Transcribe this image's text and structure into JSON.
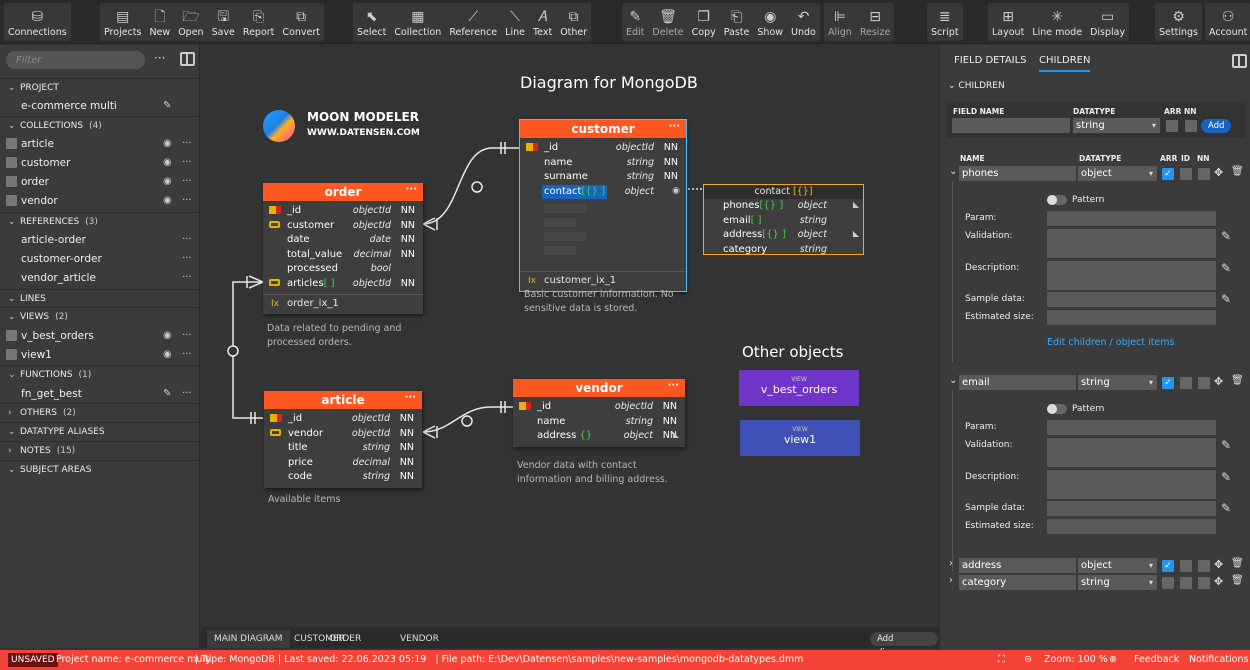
{
  "toolbar": {
    "groups": [
      [
        {
          "icon": "database-icon",
          "label": "Connections"
        }
      ],
      [
        {
          "icon": "projects-icon",
          "label": "Projects"
        },
        {
          "icon": "new-file-icon",
          "label": "New"
        },
        {
          "icon": "folder-open-icon",
          "label": "Open"
        },
        {
          "icon": "save-icon",
          "label": "Save"
        },
        {
          "icon": "report-icon",
          "label": "Report"
        },
        {
          "icon": "convert-icon",
          "label": "Convert"
        }
      ],
      [
        {
          "icon": "cursor-icon",
          "label": "Select"
        },
        {
          "icon": "collection-icon",
          "label": "Collection"
        },
        {
          "icon": "reference-icon",
          "label": "Reference"
        },
        {
          "icon": "line-icon",
          "label": "Line"
        },
        {
          "icon": "text-icon",
          "label": "Text"
        },
        {
          "icon": "other-icon",
          "label": "Other"
        }
      ],
      [
        {
          "icon": "edit-icon",
          "label": "Edit",
          "disabled": true
        },
        {
          "icon": "trash-icon",
          "label": "Delete",
          "disabled": true
        },
        {
          "icon": "copy-icon",
          "label": "Copy"
        },
        {
          "icon": "paste-icon",
          "label": "Paste"
        },
        {
          "icon": "eye-icon",
          "label": "Show"
        },
        {
          "icon": "undo-icon",
          "label": "Undo"
        }
      ],
      [
        {
          "icon": "align-icon",
          "label": "Align",
          "disabled": true
        },
        {
          "icon": "resize-icon",
          "label": "Resize",
          "disabled": true
        }
      ],
      [
        {
          "icon": "script-icon",
          "label": "Script"
        }
      ],
      [
        {
          "icon": "layout-icon",
          "label": "Layout"
        },
        {
          "icon": "line-mode-icon",
          "label": "Line mode"
        },
        {
          "icon": "display-icon",
          "label": "Display"
        }
      ],
      [
        {
          "icon": "gear-icon",
          "label": "Settings"
        }
      ],
      [
        {
          "icon": "user-icon",
          "label": "Account"
        }
      ]
    ]
  },
  "sidebar": {
    "filter_placeholder": "Filter",
    "project": {
      "title": "PROJECT",
      "name": "e-commerce multi"
    },
    "collections": {
      "title": "COLLECTIONS",
      "count": "(4)",
      "items": [
        "article",
        "customer",
        "order",
        "vendor"
      ]
    },
    "references": {
      "title": "REFERENCES",
      "count": "(3)",
      "items": [
        "article-order",
        "customer-order",
        "vendor_article"
      ]
    },
    "lines": {
      "title": "LINES"
    },
    "views": {
      "title": "VIEWS",
      "count": "(2)",
      "items": [
        "v_best_orders",
        "view1"
      ]
    },
    "functions": {
      "title": "FUNCTIONS",
      "count": "(1)",
      "items": [
        "fn_get_best"
      ]
    },
    "others": {
      "title": "OTHERS",
      "count": "(2)"
    },
    "aliases": {
      "title": "DATATYPE ALIASES"
    },
    "notes": {
      "title": "NOTES",
      "count": "(15)"
    },
    "subject_areas": {
      "title": "SUBJECT AREAS"
    }
  },
  "diagram": {
    "title": "Diagram for MongoDB",
    "logo": {
      "name": "MOON MODELER",
      "url": "WWW.DATENSEN.COM"
    },
    "entities": {
      "order": {
        "name": "order",
        "fields": [
          {
            "icon": "key",
            "name": "_id",
            "type": "objectId",
            "nn": "NN"
          },
          {
            "icon": "fk",
            "name": "customer",
            "type": "objectId",
            "nn": "NN"
          },
          {
            "icon": "",
            "name": "date",
            "type": "date",
            "nn": "NN"
          },
          {
            "icon": "",
            "name": "total_value",
            "type": "decimal",
            "nn": "NN"
          },
          {
            "icon": "",
            "name": "processed",
            "type": "bool",
            "nn": ""
          },
          {
            "icon": "fk",
            "name": "articles",
            "suffix": "[ ]",
            "type": "objectId",
            "nn": "NN"
          }
        ],
        "index": "order_ix_1",
        "note": "Data related to pending and processed orders."
      },
      "customer": {
        "name": "customer",
        "fields": [
          {
            "icon": "key",
            "name": "_id",
            "type": "objectId",
            "nn": "NN"
          },
          {
            "icon": "",
            "name": "name",
            "type": "string",
            "nn": "NN"
          },
          {
            "icon": "",
            "name": "surname",
            "type": "string",
            "nn": "NN"
          },
          {
            "icon": "",
            "name": "contact",
            "suffix": "[{} ]",
            "type": "object",
            "nn": ""
          }
        ],
        "index": "customer_ix_1",
        "note": "Basic customer information. No sensitive data is stored."
      },
      "article": {
        "name": "article",
        "fields": [
          {
            "icon": "key",
            "name": "_id",
            "type": "objectId",
            "nn": "NN"
          },
          {
            "icon": "fk",
            "name": "vendor",
            "type": "objectId",
            "nn": "NN"
          },
          {
            "icon": "",
            "name": "title",
            "type": "string",
            "nn": "NN"
          },
          {
            "icon": "",
            "name": "price",
            "type": "decimal",
            "nn": "NN"
          },
          {
            "icon": "",
            "name": "code",
            "type": "string",
            "nn": "NN"
          }
        ],
        "note": "Available items"
      },
      "vendor": {
        "name": "vendor",
        "fields": [
          {
            "icon": "key",
            "name": "_id",
            "type": "objectId",
            "nn": "NN"
          },
          {
            "icon": "",
            "name": "name",
            "type": "string",
            "nn": "NN"
          },
          {
            "icon": "",
            "name": "address",
            "suffix": " {}",
            "type": "object",
            "nn": "NN"
          }
        ],
        "note": "Vendor data with contact information and billing address."
      },
      "contact": {
        "name": "contact",
        "suffix": " [{}]",
        "fields": [
          {
            "name": "phones",
            "suffix": "[{} ]",
            "type": "object"
          },
          {
            "name": "email",
            "suffix": "[ ]",
            "type": "string"
          },
          {
            "name": "address",
            "suffix": "[{} ]",
            "type": "object"
          },
          {
            "name": "category",
            "suffix": "",
            "type": "string"
          }
        ]
      }
    },
    "other_objects_title": "Other objects",
    "views": [
      {
        "kind": "VIEW",
        "name": "v_best_orders",
        "color": "#6f35c8"
      },
      {
        "kind": "VIEW",
        "name": "view1",
        "color": "#3f51b5"
      }
    ],
    "tabs": [
      "MAIN DIAGRAM",
      "CUSTOMER",
      "ORDER",
      "VENDOR"
    ],
    "add_diagram": "Add diagram"
  },
  "right_panel": {
    "tabs": [
      "FIELD DETAILS",
      "CHILDREN"
    ],
    "active_tab": "CHILDREN",
    "section": "CHILDREN",
    "new_field": {
      "name_label": "FIELD NAME",
      "datatype_label": "DATATYPE",
      "arr_label": "ARR",
      "nn_label": "NN",
      "datatype": "string",
      "add": "Add"
    },
    "list_headers": {
      "name": "NAME",
      "datatype": "DATATYPE",
      "arr": "ARR",
      "id": "ID",
      "nn": "NN"
    },
    "children": [
      {
        "name": "phones",
        "datatype": "object",
        "arr": true,
        "id": false,
        "nn": false,
        "expanded": true
      },
      {
        "name": "email",
        "datatype": "string",
        "arr": true,
        "id": false,
        "nn": false,
        "expanded": true
      },
      {
        "name": "address",
        "datatype": "object",
        "arr": true,
        "id": false,
        "nn": false,
        "expanded": false
      },
      {
        "name": "category",
        "datatype": "string",
        "arr": false,
        "id": false,
        "nn": false,
        "expanded": false
      }
    ],
    "detail_labels": {
      "pattern": "Pattern",
      "param": "Param:",
      "validation": "Validation:",
      "description": "Description:",
      "sample": "Sample data:",
      "size": "Estimated size:"
    },
    "edit_children_link": "Edit children / object items"
  },
  "status": {
    "badge": "UNSAVED",
    "project": "Project name: e-commerce multi",
    "info": "| Type: MongoDB | Last saved: 22.06.2023 05:19   | File path: E:\\Dev\\Datensen\\samples\\new-samples\\mongodb-datatypes.dmm",
    "zoom": "Zoom: 100 %",
    "feedback": "Feedback",
    "notifications": "Notifications"
  },
  "colors": {
    "accent": "#ff5722",
    "status_bar": "#f44336",
    "selection": "#2196f3",
    "contact_border": "#f5a623"
  }
}
